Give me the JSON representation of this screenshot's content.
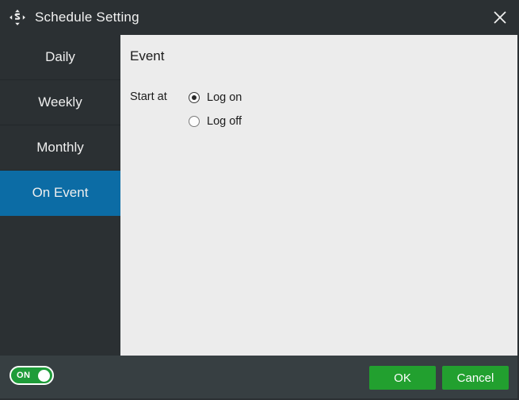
{
  "window": {
    "title": "Schedule Setting",
    "title_icon": "schedule-sync-arrows-icon",
    "close_icon": "close-icon",
    "colors": {
      "titlebar": "#2b3033",
      "sidebar": "#2b3033",
      "selected_tab": "#0c6ca5",
      "content": "#ececec",
      "footer": "#373f42",
      "button_green": "#22a02f",
      "toggle_green": "#1f9c3a"
    }
  },
  "sidebar": {
    "items": [
      {
        "label": "Daily",
        "selected": false
      },
      {
        "label": "Weekly",
        "selected": false
      },
      {
        "label": "Monthly",
        "selected": false
      },
      {
        "label": "On Event",
        "selected": true
      }
    ]
  },
  "content": {
    "heading": "Event",
    "start_at_label": "Start at",
    "options": [
      {
        "label": "Log on",
        "checked": true
      },
      {
        "label": "Log off",
        "checked": false
      }
    ]
  },
  "footer": {
    "toggle": {
      "label": "ON",
      "state": "on"
    },
    "ok_label": "OK",
    "cancel_label": "Cancel"
  }
}
